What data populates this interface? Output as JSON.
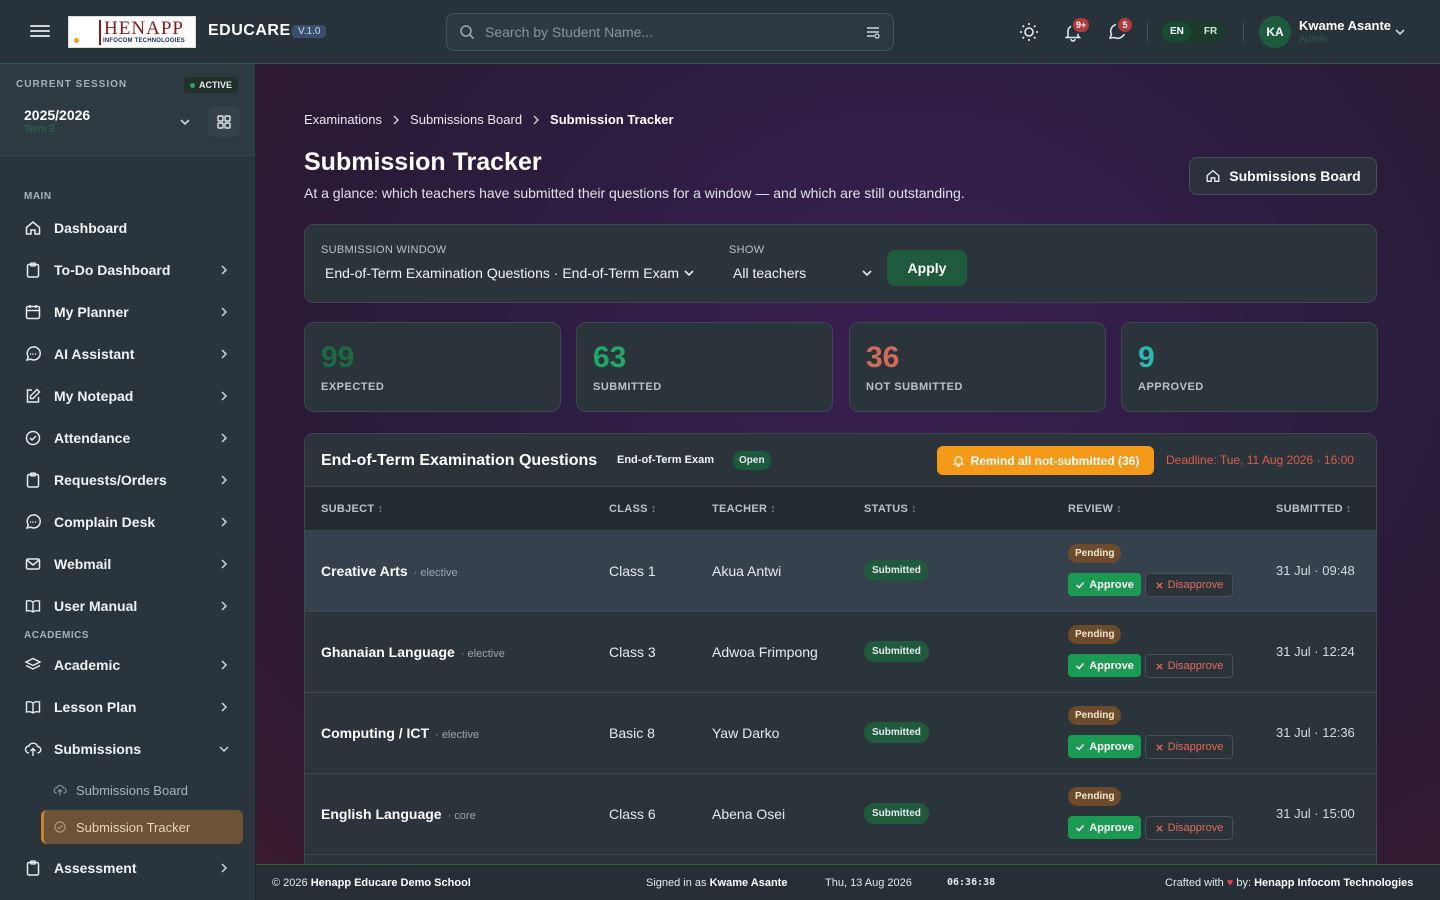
{
  "header": {
    "logo_main": "HENAPP",
    "logo_sub": "INFOCOM TECHNOLOGIES",
    "brand": "EDUCARE",
    "version": "V.1.0",
    "search_placeholder": "Search by Student Name...",
    "notifications_count": "9+",
    "messages_count": "5",
    "lang_en": "EN",
    "lang_fr": "FR",
    "user_initials": "KA",
    "user_name": "Kwame Asante",
    "user_role": "Admin"
  },
  "sidebar": {
    "session_label": "CURRENT SESSION",
    "session_status": "ACTIVE",
    "session_year": "2025/2026",
    "session_term": "Term 3",
    "section_main": "MAIN",
    "section_academics": "ACADEMICS",
    "items": [
      {
        "label": "Dashboard"
      },
      {
        "label": "To-Do Dashboard"
      },
      {
        "label": "My Planner"
      },
      {
        "label": "AI Assistant"
      },
      {
        "label": "My Notepad"
      },
      {
        "label": "Attendance"
      },
      {
        "label": "Requests/Orders"
      },
      {
        "label": "Complain Desk"
      },
      {
        "label": "Webmail"
      },
      {
        "label": "User Manual"
      },
      {
        "label": "Academic"
      },
      {
        "label": "Lesson Plan"
      },
      {
        "label": "Submissions"
      },
      {
        "label": "Assessment"
      }
    ],
    "sub_items": [
      {
        "label": "Submissions Board"
      },
      {
        "label": "Submission Tracker"
      }
    ]
  },
  "page": {
    "breadcrumbs": [
      "Examinations",
      "Submissions Board",
      "Submission Tracker"
    ],
    "title": "Submission Tracker",
    "subtitle": "At a glance: which teachers have submitted their questions for a window — and which are still outstanding.",
    "board_button": "Submissions Board"
  },
  "filters": {
    "window_label": "SUBMISSION WINDOW",
    "window_value": "End-of-Term Examination Questions · End-of-Term Exam",
    "show_label": "SHOW",
    "show_value": "All teachers",
    "apply_label": "Apply"
  },
  "stats": [
    {
      "value": "99",
      "label": "EXPECTED",
      "color": "#1a6b44"
    },
    {
      "value": "63",
      "label": "SUBMITTED",
      "color": "#20a867"
    },
    {
      "value": "36",
      "label": "NOT SUBMITTED",
      "color": "#d06b5a"
    },
    {
      "value": "9",
      "label": "APPROVED",
      "color": "#2bb8b0"
    }
  ],
  "table": {
    "title": "End-of-Term Examination Questions",
    "exam_type": "End-of-Term Exam",
    "status": "Open",
    "remind_label": "Remind all not-submitted (36)",
    "deadline": "Deadline: Tue, 11 Aug 2026 · 16:00",
    "columns": [
      "SUBJECT",
      "CLASS",
      "TEACHER",
      "STATUS",
      "REVIEW",
      "SUBMITTED"
    ],
    "approve_label": "Approve",
    "disapprove_label": "Disapprove",
    "rows": [
      {
        "subject": "Creative Arts",
        "type": "· elective",
        "class": "Class 1",
        "teacher": "Akua Antwi",
        "status": "Submitted",
        "review": "Pending",
        "submitted": "31 Jul · 09:48"
      },
      {
        "subject": "Ghanaian Language",
        "type": "· elective",
        "class": "Class 3",
        "teacher": "Adwoa Frimpong",
        "status": "Submitted",
        "review": "Pending",
        "submitted": "31 Jul · 12:24"
      },
      {
        "subject": "Computing / ICT",
        "type": "· elective",
        "class": "Basic 8",
        "teacher": "Yaw Darko",
        "status": "Submitted",
        "review": "Pending",
        "submitted": "31 Jul · 12:36"
      },
      {
        "subject": "English Language",
        "type": "· core",
        "class": "Class 6",
        "teacher": "Abena Osei",
        "status": "Submitted",
        "review": "Pending",
        "submitted": "31 Jul · 15:00"
      }
    ]
  },
  "footer": {
    "copyright": "© 2026",
    "school": "Henapp Educare Demo School",
    "signed_in_prefix": "Signed in as",
    "signed_in_user": "Kwame Asante",
    "date": "Thu, 13 Aug 2026",
    "time": "06:36:38",
    "crafted_prefix": "Crafted with",
    "crafted_by": "by:",
    "company": "Henapp Infocom Technologies"
  }
}
